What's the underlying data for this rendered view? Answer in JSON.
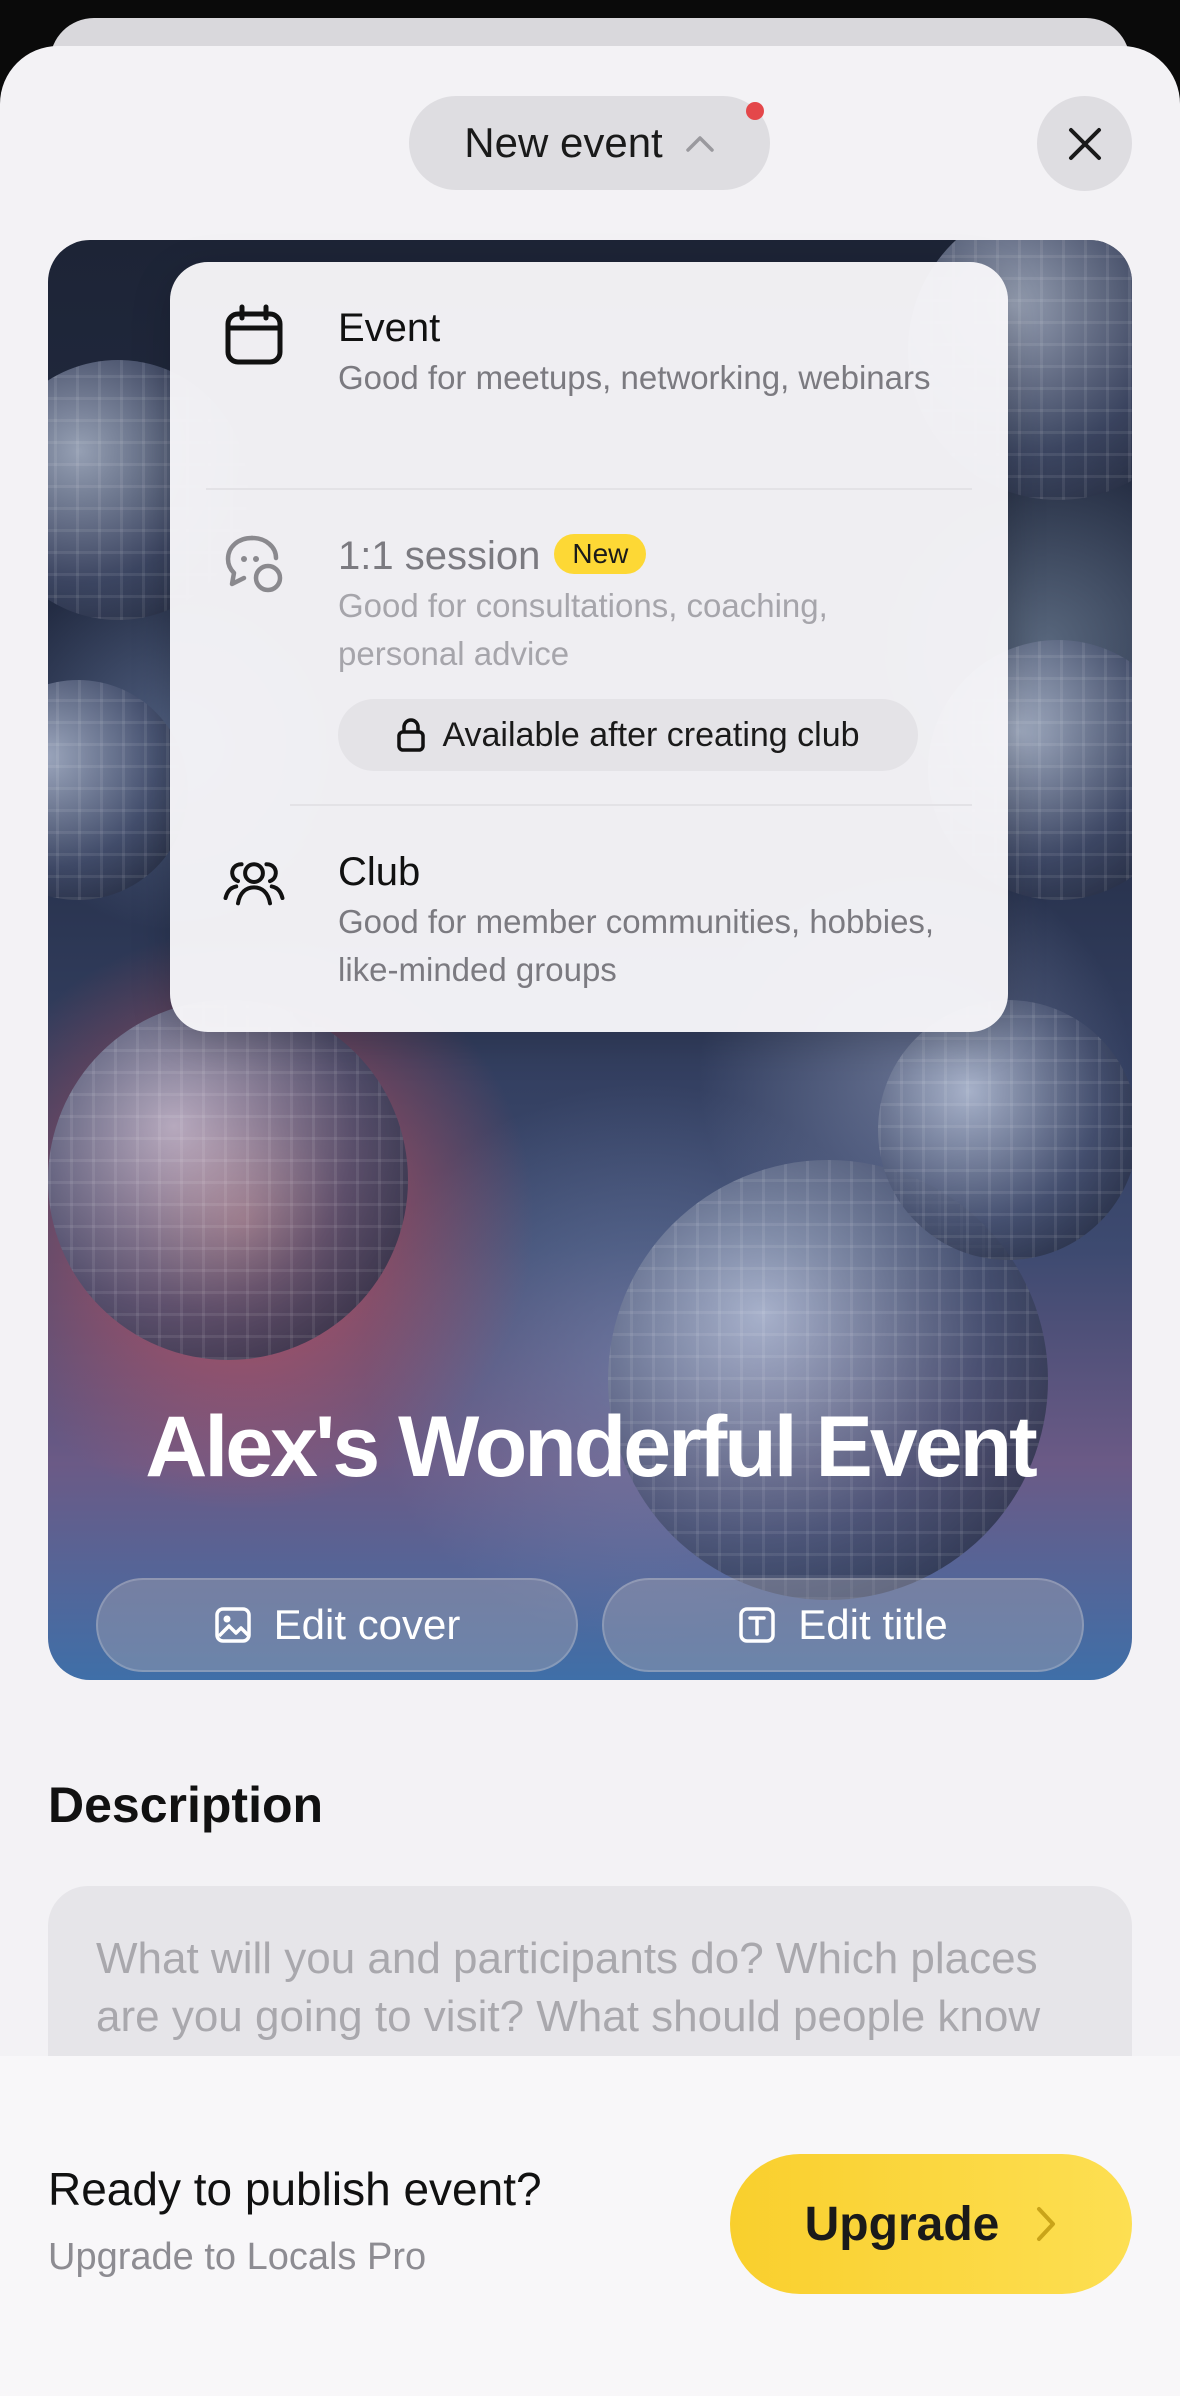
{
  "header": {
    "event_type_label": "New event",
    "close_label": "Close"
  },
  "menu": {
    "items": [
      {
        "title": "Event",
        "description": "Good for meetups, networking, webinars",
        "icon": "calendar-icon"
      },
      {
        "title": "1:1 session",
        "badge": "New",
        "description": "Good for consultations, coaching, personal advice",
        "locked_label": "Available after creating club",
        "icon": "chat-bubbles-icon"
      },
      {
        "title": "Club",
        "description": "Good for member communities, hobbies, like-minded groups",
        "icon": "people-group-icon"
      }
    ]
  },
  "cover": {
    "title": "Alex's Wonderful Event",
    "edit_cover_label": "Edit cover",
    "edit_title_label": "Edit title"
  },
  "description": {
    "heading": "Description",
    "placeholder": "What will you and participants do? Which places are you going to visit? What should people know before start?"
  },
  "bottom_bar": {
    "title": "Ready to publish event?",
    "subtitle": "Upgrade to Locals Pro",
    "upgrade_label": "Upgrade"
  },
  "colors": {
    "accent_yellow": "#fdd835",
    "notification_red": "#e4474a",
    "sheet_bg": "#f3f2f5"
  }
}
